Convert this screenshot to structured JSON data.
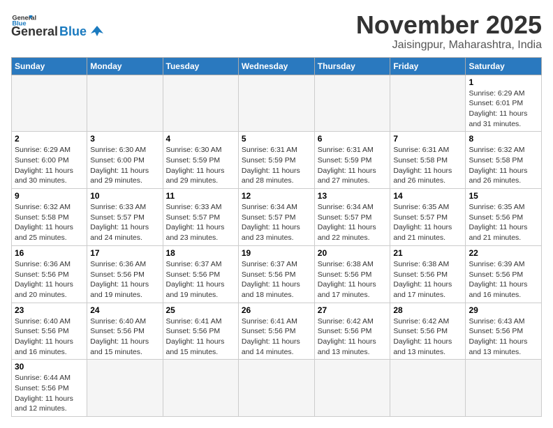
{
  "logo": {
    "general": "General",
    "blue": "Blue"
  },
  "title": {
    "month": "November 2025",
    "location": "Jaisingpur, Maharashtra, India"
  },
  "headers": [
    "Sunday",
    "Monday",
    "Tuesday",
    "Wednesday",
    "Thursday",
    "Friday",
    "Saturday"
  ],
  "weeks": [
    [
      {
        "day": "",
        "sunrise": "",
        "sunset": "",
        "daylight": "",
        "empty": true
      },
      {
        "day": "",
        "sunrise": "",
        "sunset": "",
        "daylight": "",
        "empty": true
      },
      {
        "day": "",
        "sunrise": "",
        "sunset": "",
        "daylight": "",
        "empty": true
      },
      {
        "day": "",
        "sunrise": "",
        "sunset": "",
        "daylight": "",
        "empty": true
      },
      {
        "day": "",
        "sunrise": "",
        "sunset": "",
        "daylight": "",
        "empty": true
      },
      {
        "day": "",
        "sunrise": "",
        "sunset": "",
        "daylight": "",
        "empty": true
      },
      {
        "day": "1",
        "sunrise": "Sunrise: 6:29 AM",
        "sunset": "Sunset: 6:01 PM",
        "daylight": "Daylight: 11 hours and 31 minutes.",
        "empty": false
      }
    ],
    [
      {
        "day": "2",
        "sunrise": "Sunrise: 6:29 AM",
        "sunset": "Sunset: 6:00 PM",
        "daylight": "Daylight: 11 hours and 30 minutes.",
        "empty": false
      },
      {
        "day": "3",
        "sunrise": "Sunrise: 6:30 AM",
        "sunset": "Sunset: 6:00 PM",
        "daylight": "Daylight: 11 hours and 29 minutes.",
        "empty": false
      },
      {
        "day": "4",
        "sunrise": "Sunrise: 6:30 AM",
        "sunset": "Sunset: 5:59 PM",
        "daylight": "Daylight: 11 hours and 29 minutes.",
        "empty": false
      },
      {
        "day": "5",
        "sunrise": "Sunrise: 6:31 AM",
        "sunset": "Sunset: 5:59 PM",
        "daylight": "Daylight: 11 hours and 28 minutes.",
        "empty": false
      },
      {
        "day": "6",
        "sunrise": "Sunrise: 6:31 AM",
        "sunset": "Sunset: 5:59 PM",
        "daylight": "Daylight: 11 hours and 27 minutes.",
        "empty": false
      },
      {
        "day": "7",
        "sunrise": "Sunrise: 6:31 AM",
        "sunset": "Sunset: 5:58 PM",
        "daylight": "Daylight: 11 hours and 26 minutes.",
        "empty": false
      },
      {
        "day": "8",
        "sunrise": "Sunrise: 6:32 AM",
        "sunset": "Sunset: 5:58 PM",
        "daylight": "Daylight: 11 hours and 26 minutes.",
        "empty": false
      }
    ],
    [
      {
        "day": "9",
        "sunrise": "Sunrise: 6:32 AM",
        "sunset": "Sunset: 5:58 PM",
        "daylight": "Daylight: 11 hours and 25 minutes.",
        "empty": false
      },
      {
        "day": "10",
        "sunrise": "Sunrise: 6:33 AM",
        "sunset": "Sunset: 5:57 PM",
        "daylight": "Daylight: 11 hours and 24 minutes.",
        "empty": false
      },
      {
        "day": "11",
        "sunrise": "Sunrise: 6:33 AM",
        "sunset": "Sunset: 5:57 PM",
        "daylight": "Daylight: 11 hours and 23 minutes.",
        "empty": false
      },
      {
        "day": "12",
        "sunrise": "Sunrise: 6:34 AM",
        "sunset": "Sunset: 5:57 PM",
        "daylight": "Daylight: 11 hours and 23 minutes.",
        "empty": false
      },
      {
        "day": "13",
        "sunrise": "Sunrise: 6:34 AM",
        "sunset": "Sunset: 5:57 PM",
        "daylight": "Daylight: 11 hours and 22 minutes.",
        "empty": false
      },
      {
        "day": "14",
        "sunrise": "Sunrise: 6:35 AM",
        "sunset": "Sunset: 5:57 PM",
        "daylight": "Daylight: 11 hours and 21 minutes.",
        "empty": false
      },
      {
        "day": "15",
        "sunrise": "Sunrise: 6:35 AM",
        "sunset": "Sunset: 5:56 PM",
        "daylight": "Daylight: 11 hours and 21 minutes.",
        "empty": false
      }
    ],
    [
      {
        "day": "16",
        "sunrise": "Sunrise: 6:36 AM",
        "sunset": "Sunset: 5:56 PM",
        "daylight": "Daylight: 11 hours and 20 minutes.",
        "empty": false
      },
      {
        "day": "17",
        "sunrise": "Sunrise: 6:36 AM",
        "sunset": "Sunset: 5:56 PM",
        "daylight": "Daylight: 11 hours and 19 minutes.",
        "empty": false
      },
      {
        "day": "18",
        "sunrise": "Sunrise: 6:37 AM",
        "sunset": "Sunset: 5:56 PM",
        "daylight": "Daylight: 11 hours and 19 minutes.",
        "empty": false
      },
      {
        "day": "19",
        "sunrise": "Sunrise: 6:37 AM",
        "sunset": "Sunset: 5:56 PM",
        "daylight": "Daylight: 11 hours and 18 minutes.",
        "empty": false
      },
      {
        "day": "20",
        "sunrise": "Sunrise: 6:38 AM",
        "sunset": "Sunset: 5:56 PM",
        "daylight": "Daylight: 11 hours and 17 minutes.",
        "empty": false
      },
      {
        "day": "21",
        "sunrise": "Sunrise: 6:38 AM",
        "sunset": "Sunset: 5:56 PM",
        "daylight": "Daylight: 11 hours and 17 minutes.",
        "empty": false
      },
      {
        "day": "22",
        "sunrise": "Sunrise: 6:39 AM",
        "sunset": "Sunset: 5:56 PM",
        "daylight": "Daylight: 11 hours and 16 minutes.",
        "empty": false
      }
    ],
    [
      {
        "day": "23",
        "sunrise": "Sunrise: 6:40 AM",
        "sunset": "Sunset: 5:56 PM",
        "daylight": "Daylight: 11 hours and 16 minutes.",
        "empty": false
      },
      {
        "day": "24",
        "sunrise": "Sunrise: 6:40 AM",
        "sunset": "Sunset: 5:56 PM",
        "daylight": "Daylight: 11 hours and 15 minutes.",
        "empty": false
      },
      {
        "day": "25",
        "sunrise": "Sunrise: 6:41 AM",
        "sunset": "Sunset: 5:56 PM",
        "daylight": "Daylight: 11 hours and 15 minutes.",
        "empty": false
      },
      {
        "day": "26",
        "sunrise": "Sunrise: 6:41 AM",
        "sunset": "Sunset: 5:56 PM",
        "daylight": "Daylight: 11 hours and 14 minutes.",
        "empty": false
      },
      {
        "day": "27",
        "sunrise": "Sunrise: 6:42 AM",
        "sunset": "Sunset: 5:56 PM",
        "daylight": "Daylight: 11 hours and 13 minutes.",
        "empty": false
      },
      {
        "day": "28",
        "sunrise": "Sunrise: 6:42 AM",
        "sunset": "Sunset: 5:56 PM",
        "daylight": "Daylight: 11 hours and 13 minutes.",
        "empty": false
      },
      {
        "day": "29",
        "sunrise": "Sunrise: 6:43 AM",
        "sunset": "Sunset: 5:56 PM",
        "daylight": "Daylight: 11 hours and 13 minutes.",
        "empty": false
      }
    ],
    [
      {
        "day": "30",
        "sunrise": "Sunrise: 6:44 AM",
        "sunset": "Sunset: 5:56 PM",
        "daylight": "Daylight: 11 hours and 12 minutes.",
        "empty": false
      },
      {
        "day": "",
        "sunrise": "",
        "sunset": "",
        "daylight": "",
        "empty": true
      },
      {
        "day": "",
        "sunrise": "",
        "sunset": "",
        "daylight": "",
        "empty": true
      },
      {
        "day": "",
        "sunrise": "",
        "sunset": "",
        "daylight": "",
        "empty": true
      },
      {
        "day": "",
        "sunrise": "",
        "sunset": "",
        "daylight": "",
        "empty": true
      },
      {
        "day": "",
        "sunrise": "",
        "sunset": "",
        "daylight": "",
        "empty": true
      },
      {
        "day": "",
        "sunrise": "",
        "sunset": "",
        "daylight": "",
        "empty": true
      }
    ]
  ]
}
